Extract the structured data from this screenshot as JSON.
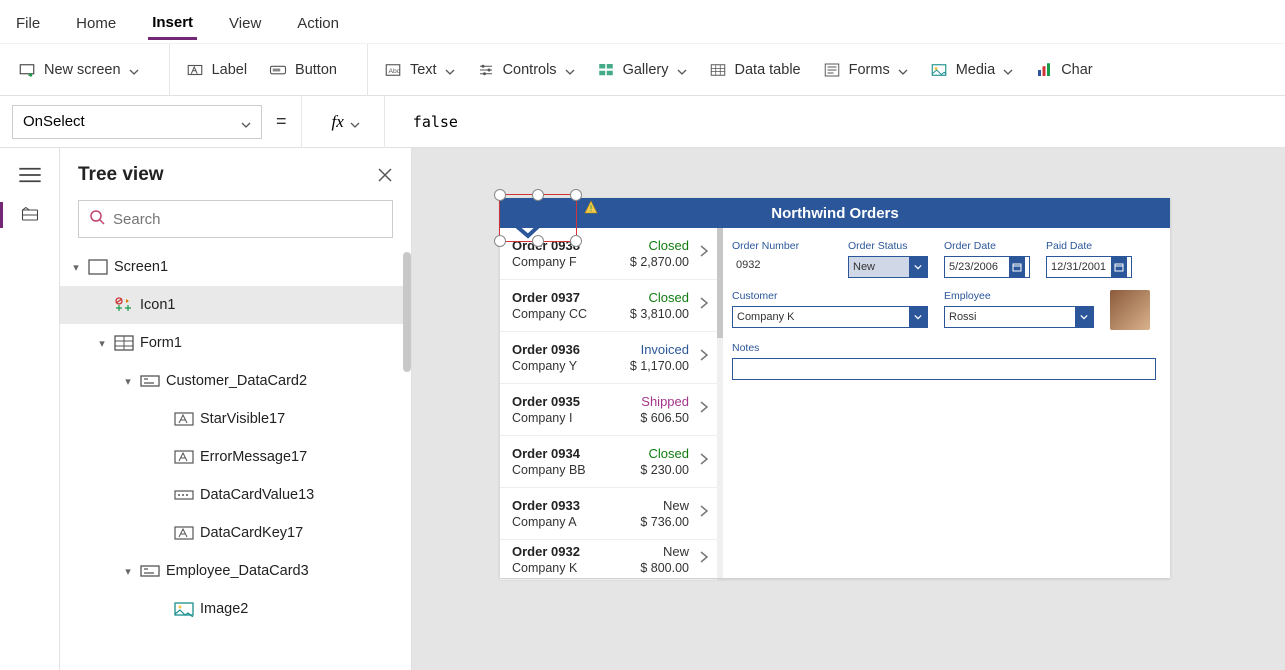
{
  "menu": {
    "items": [
      "File",
      "Home",
      "Insert",
      "View",
      "Action"
    ],
    "active": "Insert"
  },
  "ribbon": {
    "new_screen": "New screen",
    "label": "Label",
    "button": "Button",
    "text": "Text",
    "controls": "Controls",
    "gallery": "Gallery",
    "data_table": "Data table",
    "forms": "Forms",
    "media": "Media",
    "charts": "Char"
  },
  "formula": {
    "property": "OnSelect",
    "value": "false"
  },
  "tree": {
    "title": "Tree view",
    "search_placeholder": "Search",
    "nodes": {
      "screen1": "Screen1",
      "icon1": "Icon1",
      "form1": "Form1",
      "customer_dc": "Customer_DataCard2",
      "starvis": "StarVisible17",
      "errmsg": "ErrorMessage17",
      "dcval": "DataCardValue13",
      "dckey": "DataCardKey17",
      "employee_dc": "Employee_DataCard3",
      "image2": "Image2"
    }
  },
  "app": {
    "title": "Northwind Orders",
    "orders": [
      {
        "id": "Order 0938",
        "company": "Company F",
        "status": "Closed",
        "amount": "$ 2,870.00"
      },
      {
        "id": "Order 0937",
        "company": "Company CC",
        "status": "Closed",
        "amount": "$ 3,810.00"
      },
      {
        "id": "Order 0936",
        "company": "Company Y",
        "status": "Invoiced",
        "amount": "$ 1,170.00"
      },
      {
        "id": "Order 0935",
        "company": "Company I",
        "status": "Shipped",
        "amount": "$ 606.50"
      },
      {
        "id": "Order 0934",
        "company": "Company BB",
        "status": "Closed",
        "amount": "$ 230.00"
      },
      {
        "id": "Order 0933",
        "company": "Company A",
        "status": "New",
        "amount": "$ 736.00"
      },
      {
        "id": "Order 0932",
        "company": "Company K",
        "status": "New",
        "amount": "$ 800.00"
      }
    ],
    "detail": {
      "labels": {
        "order_number": "Order Number",
        "order_status": "Order Status",
        "order_date": "Order Date",
        "paid_date": "Paid Date",
        "customer": "Customer",
        "employee": "Employee",
        "notes": "Notes"
      },
      "order_number": "0932",
      "order_status": "New",
      "order_date": "5/23/2006",
      "paid_date": "12/31/2001",
      "customer": "Company K",
      "employee": "Rossi"
    }
  }
}
